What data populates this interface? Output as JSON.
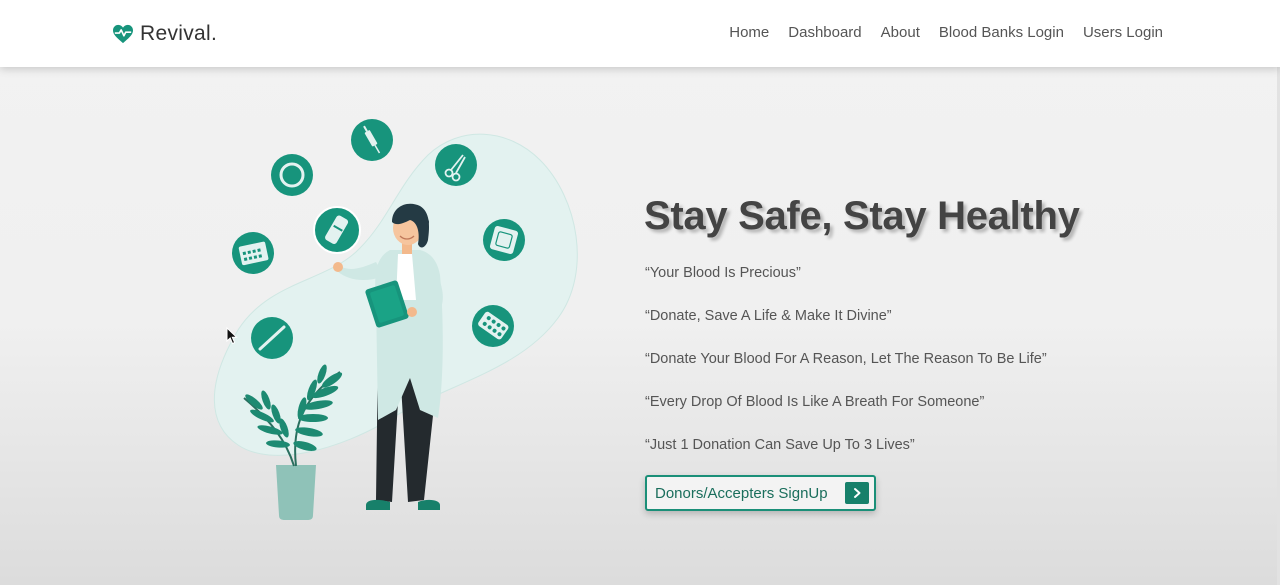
{
  "brand": {
    "name": "Revival.",
    "icon": "heart-pulse-icon",
    "color": "#17947c"
  },
  "nav": {
    "items": [
      {
        "label": "Home"
      },
      {
        "label": "Dashboard"
      },
      {
        "label": "About"
      },
      {
        "label": "Blood Banks Login"
      },
      {
        "label": "Users Login"
      }
    ]
  },
  "hero": {
    "title": "Stay Safe, Stay Healthy",
    "quotes": [
      "“Your Blood Is Precious”",
      "“Donate, Save A Life & Make It Divine”",
      "“Donate Your Blood For A Reason, Let The Reason To Be Life”",
      "“Every Drop Of Blood Is Like A Breath For Someone”",
      "“Just 1 Donation Can Save Up To 3 Lives”"
    ],
    "cta": {
      "label": "Donors/Accepters SignUp",
      "icon": "chevron-right-icon"
    }
  },
  "illustration": {
    "subject": "doctor-with-clipboard",
    "medical_icons": [
      "ring-icon",
      "syringe-icon",
      "scissors-icon",
      "vial-icon",
      "calendar-icon",
      "bandage-icon",
      "pills-icon",
      "thermometer-icon",
      "plant-icon"
    ]
  },
  "colors": {
    "accent": "#17947c",
    "accent_dark": "#17806a",
    "blob": "#e3f2f0"
  }
}
